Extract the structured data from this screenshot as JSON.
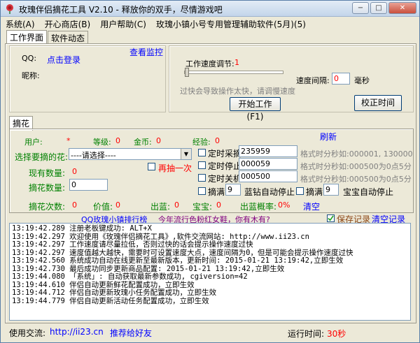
{
  "window": {
    "title": "玫瑰伴侣摘花工具 V2.10 - 释放你的双手，尽情游戏吧",
    "min": "−",
    "max": "□",
    "close": "✕"
  },
  "menu": [
    "系统(A)",
    "开心商店(B)",
    "用户帮助(C)",
    "玫瑰小镇小号专用管理辅助软件(5月)(5)"
  ],
  "tabs": [
    "工作界面",
    "软件动态"
  ],
  "login": {
    "qq_label": "QQ:",
    "login_link": "点击登录",
    "nick_label": "昵称:",
    "watch_link": "查看监控"
  },
  "speed": {
    "label": "工作速度调节:",
    "value": "1",
    "hint": "过快会导致操作太快，请调慢速度",
    "interval_label": "速度间隔:",
    "interval_value": "0",
    "interval_unit": "毫秒",
    "start_button": "开始工作(F1)",
    "sync_button": "校正时间"
  },
  "subtab": "摘花",
  "stats": {
    "user_label": "用户:",
    "user_value": "*",
    "level_label": "等级:",
    "level_value": "0",
    "gold_label": "金币:",
    "gold_value": "0",
    "exp_label": "经验:",
    "exp_value": "0",
    "refresh": "刷新"
  },
  "flower": {
    "select_label": "选择要摘的花:",
    "select_value": "----请选择----",
    "again_label": "再抽一次",
    "current_label": "现有数量:",
    "current_value": "0",
    "pick_label": "摘花数量:",
    "pick_value": "0"
  },
  "timers": {
    "collect_label": "定时采摘",
    "collect_value": "235959",
    "collect_hint": "格式时分秒如:000001, 130000",
    "stop_label": "定时停止",
    "stop_value": "000059",
    "stop_hint": "格式时分秒如:000500为0点5分",
    "shutdown_label": "定时关机",
    "shutdown_value": "000500",
    "shutdown_hint": "格式时分秒如:000500为0点5分",
    "full1_label": "摘满",
    "full1_value": "9",
    "blue_stop": "蓝钻自动停止",
    "full2_label": "摘满",
    "full2_value": "9",
    "treasure_stop": "宝宝自动停止"
  },
  "counters": {
    "count_label": "摘花次数:",
    "count_value": "0",
    "value_label": "价值:",
    "value_value": "0",
    "blue_label": "出蓝:",
    "blue_value": "0",
    "treasure_label": "宝宝:",
    "treasure_value": "0",
    "rate_label": "出蓝概率:",
    "rate_value": "0%",
    "clear": "清空"
  },
  "rank_link": "QQ玫瑰小镇排行榜",
  "trend_link": "今年流行色粉红女鞋，你有木有?",
  "save_log_label": "保存记录",
  "clear_log": "清空记录",
  "log": [
    "13:19:42.289 注册老板键成功: ALT+X",
    "13:19:42.297 欢迎使用《玫瑰伴侣摘花工具》,软件交流网站: http://www.ii23.cn",
    "13:19:42.297 工作速度请尽量拉低，否则过快的话会提示操作速度过快",
    "13:19:42.297 速度值越大越快，需要时可设置速度大点，速度间隔为0，但是可能会提示操作速度过快",
    "13:19:42.560 系统成功自动在线更新至最新版本，更新时间: 2015-01-21 13:19:42,立即生效",
    "13:19:42.730 最后成功同步更新商品配置: 2015-01-21 13:19:42,立即生效",
    "13:19:44.080 「系统」: 自动获取最新参数成功, cgiversion=42",
    "13:19:44.610 伴侣自动更新鲜花配置成功，立即生效",
    "13:19:44.712 伴侣自动更新玫瑰小任务配置成功，立即生效",
    "13:19:44.779 伴侣自动更新活动任务配置成功，立即生效"
  ],
  "status": {
    "site_label": "使用交流:",
    "site_link": "http://ii23.cn",
    "recommend": "推荐给好友",
    "runtime_label": "运行时间:",
    "runtime_value": "30秒"
  },
  "colors": {
    "accent_red": "#ff0000",
    "link_blue": "#0000ff",
    "label_green": "#008000"
  }
}
